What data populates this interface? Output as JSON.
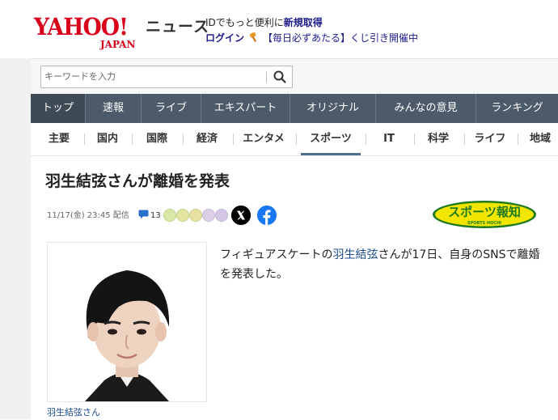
{
  "header": {
    "logo_main": "YAHOO!",
    "logo_sub": "JAPAN",
    "service_name": "ニュース",
    "promo_prefix": "IDでもっと便利に",
    "register_label": "新規取得",
    "login_label": "ログイン",
    "lottery_label": "【毎日必ずあたる】くじ引き開催中"
  },
  "search": {
    "placeholder": "キーワードを入力"
  },
  "main_nav": {
    "items": [
      "トップ",
      "速報",
      "ライブ",
      "エキスパート",
      "オリジナル",
      "みんなの意見",
      "ランキング"
    ],
    "active_index": 0
  },
  "sub_nav": {
    "items": [
      "主要",
      "国内",
      "国際",
      "経済",
      "エンタメ",
      "スポーツ",
      "IT",
      "科学",
      "ライフ",
      "地域"
    ],
    "active_index": 5
  },
  "article": {
    "headline": "羽生結弦さんが離婚を発表",
    "timestamp": "11/17(金) 23:45 配信",
    "comment_count": "13",
    "source_name": "スポーツ報知",
    "source_sub": "SPORTS HOCHI",
    "photo_caption": "羽生結弦さん",
    "body_link": "羽生結弦",
    "body_before": "フィギュアスケートの",
    "body_after": "さんが17日、自身のSNSで離婚を発表した。"
  },
  "colors": {
    "brand_red": "#d9001b",
    "nav_bg": "#4d5a6a",
    "link_blue": "#1a4c8f",
    "source_green": "#1f7a1f",
    "source_yellow": "#f2e600"
  }
}
